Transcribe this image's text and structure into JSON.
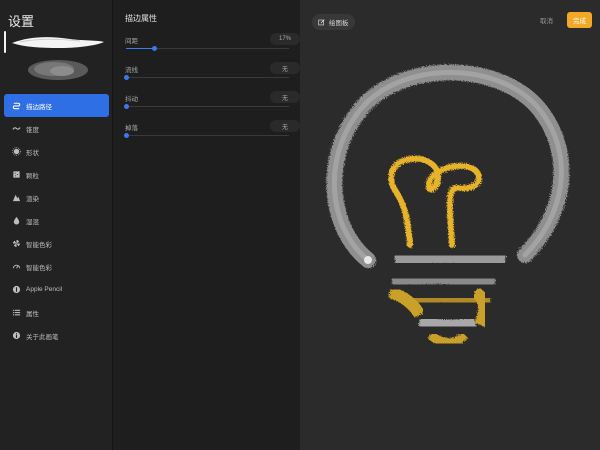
{
  "sidebar": {
    "title": "设置",
    "items": [
      {
        "label": "描边路径",
        "icon": "stroke-path-icon",
        "active": true
      },
      {
        "label": "锥度",
        "icon": "taper-icon",
        "active": false
      },
      {
        "label": "形状",
        "icon": "shape-icon",
        "active": false
      },
      {
        "label": "颗粒",
        "icon": "grain-icon",
        "active": false
      },
      {
        "label": "渲染",
        "icon": "rendering-icon",
        "active": false
      },
      {
        "label": "湿混",
        "icon": "wet-mix-icon",
        "active": false
      },
      {
        "label": "智能色彩",
        "icon": "color-dynamics-icon",
        "active": false
      },
      {
        "label": "智能色彩",
        "icon": "gauge-icon",
        "active": false
      },
      {
        "label": "Apple Pencil",
        "icon": "apple-pencil-icon",
        "active": false
      },
      {
        "label": "属性",
        "icon": "properties-icon",
        "active": false
      },
      {
        "label": "关于此画笔",
        "icon": "info-icon",
        "active": false
      }
    ]
  },
  "panel": {
    "title": "描边属性",
    "props": [
      {
        "label": "间距",
        "value": "17%",
        "level": 0.17
      },
      {
        "label": "流线",
        "value": "无",
        "level": 0
      },
      {
        "label": "抖动",
        "value": "无",
        "level": 0
      },
      {
        "label": "掉落",
        "value": "无",
        "level": 0
      }
    ]
  },
  "canvas": {
    "pad_label": "绘图板",
    "cancel_label": "取消",
    "done_label": "完成"
  },
  "colors": {
    "accent_blue": "#2f6fe6",
    "done_orange": "#f2a928",
    "bulb_gold": "#e6b32b",
    "bulb_gray": "#8f8f8f"
  }
}
